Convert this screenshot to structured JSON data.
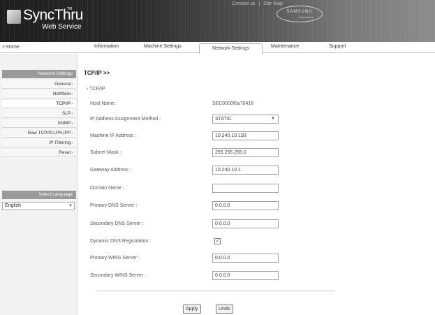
{
  "header": {
    "logo_text": "SyncThru",
    "logo_tm": "TM",
    "logo_sub": "Web Service",
    "top_links": [
      "Contact us",
      "Site Map"
    ],
    "top_links_separator": "|",
    "brand_logo": "SAMSUNG",
    "brand_logo_sub": "ELECTRONICS"
  },
  "nav": {
    "home": "> Home",
    "tabs": [
      "Information",
      "Machine Settings",
      "Network Settings",
      "Maintenance",
      "Support"
    ],
    "active_tab": "Network Settings"
  },
  "sidebar": {
    "section_title": "Network Settings",
    "items": [
      {
        "label": "General"
      },
      {
        "label": "NetWare"
      },
      {
        "label": "TCP/IP"
      },
      {
        "label": "SLP"
      },
      {
        "label": "SNMP"
      },
      {
        "label": "Raw TCP/IP,LPR,IPP"
      },
      {
        "label": "IP Filtering"
      },
      {
        "label": "Reset"
      }
    ],
    "active_item": "TCP/IP",
    "arrow_glyph": "›",
    "language_title": "Select Language",
    "language_value": "English"
  },
  "content": {
    "title": "TCP/IP >>",
    "subtitle": "› TCP/IP",
    "fields": {
      "host_name": {
        "label": "Host Name :",
        "value": "SEC0000f0a70416"
      },
      "ip_method": {
        "label": "IP Address Assignment Method :",
        "value": "STATIC"
      },
      "machine_ip": {
        "label": "Machine IP Address :",
        "value": "10.240.10.193"
      },
      "subnet_mask": {
        "label": "Subnet Mask :",
        "value": "255.255.255.0"
      },
      "gateway": {
        "label": "Gateway Address :",
        "value": "10.240.10.1"
      },
      "domain_name": {
        "label": "Domain Name :",
        "value": ""
      },
      "primary_dns": {
        "label": "Primary DNS Server :",
        "value": "0.0.0.0"
      },
      "secondary_dns": {
        "label": "Secondary DNS Server :",
        "value": "0.0.0.0"
      },
      "dynamic_dns": {
        "label": "Dynamic DNS Registration :",
        "checked": true,
        "check_glyph": "✓"
      },
      "primary_wins": {
        "label": "Primary WINS Server :",
        "value": "0.0.0.0"
      },
      "secondary_wins": {
        "label": "Secondary WINS Server :",
        "value": "0.0.0.0"
      }
    },
    "buttons": {
      "apply": "Apply",
      "undo": "Undo"
    }
  }
}
